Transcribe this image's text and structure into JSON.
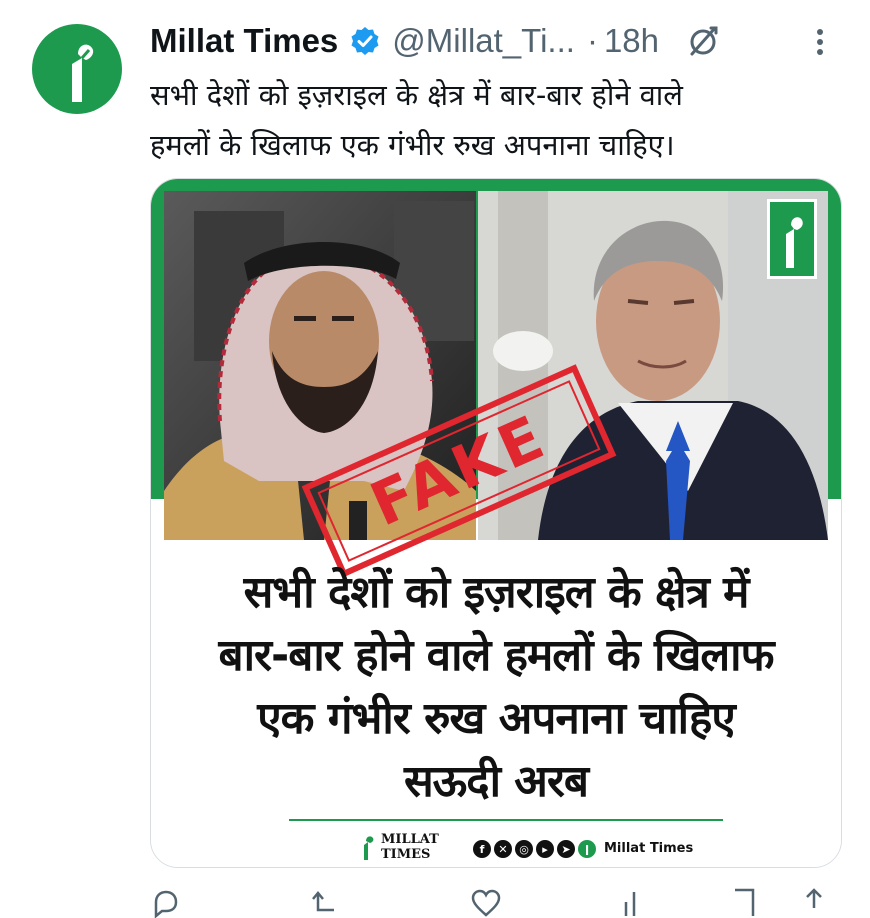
{
  "tweet": {
    "author_name": "Millat Times",
    "handle": "@Millat_Ti...",
    "separator": "·",
    "time": "18h",
    "text_line1": "सभी देशों को इज़राइल के क्षेत्र में बार-बार होने वाले",
    "text_line2": "हमलों के खिलाफ एक गंभीर रुख अपनाना चाहिए।"
  },
  "card": {
    "stamp": "FAKE",
    "headline_line1": "सभी देशों को इज़राइल के क्षेत्र में",
    "headline_line2": "बार-बार होने वाले हमलों के खिलाफ",
    "headline_line3": "एक गंभीर रुख अपनाना चाहिए",
    "headline_line4": "सऊदी अरब",
    "footer_logo_line1": "MILLAT",
    "footer_logo_line2": "TIMES",
    "footer_brand": "Millat Times"
  },
  "icons": [
    "verified-badge-icon",
    "grok-icon",
    "more-options-icon",
    "reply-icon",
    "retweet-icon",
    "like-icon",
    "views-icon",
    "bookmark-icon",
    "share-icon"
  ],
  "colors": {
    "brand_green": "#1e9a4f",
    "stamp_red": "#e0262f",
    "verified_blue": "#1d9bf0",
    "muted_text": "#536471"
  }
}
